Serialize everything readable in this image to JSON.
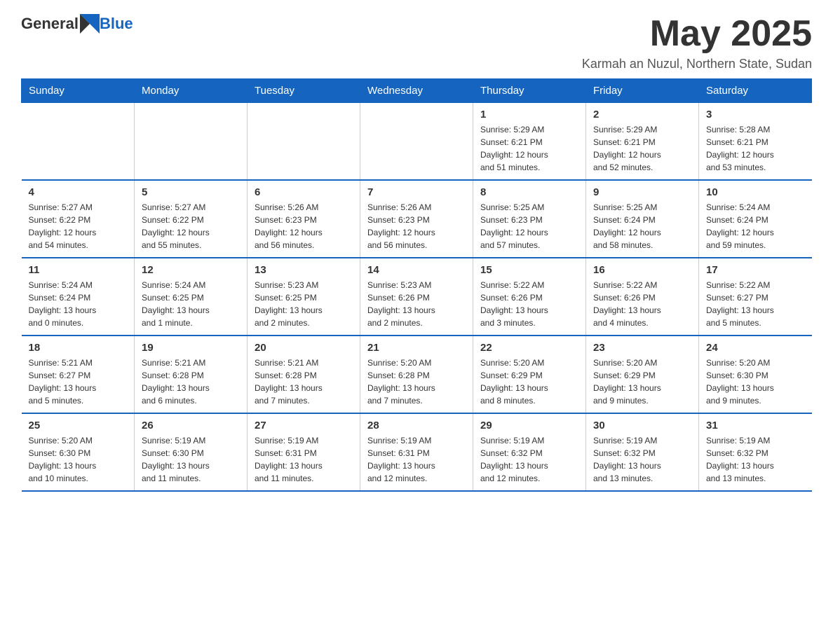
{
  "logo": {
    "general": "General",
    "blue": "Blue"
  },
  "title": {
    "month_year": "May 2025",
    "location": "Karmah an Nuzul, Northern State, Sudan"
  },
  "days_of_week": [
    "Sunday",
    "Monday",
    "Tuesday",
    "Wednesday",
    "Thursday",
    "Friday",
    "Saturday"
  ],
  "weeks": [
    [
      {
        "day": "",
        "info": ""
      },
      {
        "day": "",
        "info": ""
      },
      {
        "day": "",
        "info": ""
      },
      {
        "day": "",
        "info": ""
      },
      {
        "day": "1",
        "info": "Sunrise: 5:29 AM\nSunset: 6:21 PM\nDaylight: 12 hours\nand 51 minutes."
      },
      {
        "day": "2",
        "info": "Sunrise: 5:29 AM\nSunset: 6:21 PM\nDaylight: 12 hours\nand 52 minutes."
      },
      {
        "day": "3",
        "info": "Sunrise: 5:28 AM\nSunset: 6:21 PM\nDaylight: 12 hours\nand 53 minutes."
      }
    ],
    [
      {
        "day": "4",
        "info": "Sunrise: 5:27 AM\nSunset: 6:22 PM\nDaylight: 12 hours\nand 54 minutes."
      },
      {
        "day": "5",
        "info": "Sunrise: 5:27 AM\nSunset: 6:22 PM\nDaylight: 12 hours\nand 55 minutes."
      },
      {
        "day": "6",
        "info": "Sunrise: 5:26 AM\nSunset: 6:23 PM\nDaylight: 12 hours\nand 56 minutes."
      },
      {
        "day": "7",
        "info": "Sunrise: 5:26 AM\nSunset: 6:23 PM\nDaylight: 12 hours\nand 56 minutes."
      },
      {
        "day": "8",
        "info": "Sunrise: 5:25 AM\nSunset: 6:23 PM\nDaylight: 12 hours\nand 57 minutes."
      },
      {
        "day": "9",
        "info": "Sunrise: 5:25 AM\nSunset: 6:24 PM\nDaylight: 12 hours\nand 58 minutes."
      },
      {
        "day": "10",
        "info": "Sunrise: 5:24 AM\nSunset: 6:24 PM\nDaylight: 12 hours\nand 59 minutes."
      }
    ],
    [
      {
        "day": "11",
        "info": "Sunrise: 5:24 AM\nSunset: 6:24 PM\nDaylight: 13 hours\nand 0 minutes."
      },
      {
        "day": "12",
        "info": "Sunrise: 5:24 AM\nSunset: 6:25 PM\nDaylight: 13 hours\nand 1 minute."
      },
      {
        "day": "13",
        "info": "Sunrise: 5:23 AM\nSunset: 6:25 PM\nDaylight: 13 hours\nand 2 minutes."
      },
      {
        "day": "14",
        "info": "Sunrise: 5:23 AM\nSunset: 6:26 PM\nDaylight: 13 hours\nand 2 minutes."
      },
      {
        "day": "15",
        "info": "Sunrise: 5:22 AM\nSunset: 6:26 PM\nDaylight: 13 hours\nand 3 minutes."
      },
      {
        "day": "16",
        "info": "Sunrise: 5:22 AM\nSunset: 6:26 PM\nDaylight: 13 hours\nand 4 minutes."
      },
      {
        "day": "17",
        "info": "Sunrise: 5:22 AM\nSunset: 6:27 PM\nDaylight: 13 hours\nand 5 minutes."
      }
    ],
    [
      {
        "day": "18",
        "info": "Sunrise: 5:21 AM\nSunset: 6:27 PM\nDaylight: 13 hours\nand 5 minutes."
      },
      {
        "day": "19",
        "info": "Sunrise: 5:21 AM\nSunset: 6:28 PM\nDaylight: 13 hours\nand 6 minutes."
      },
      {
        "day": "20",
        "info": "Sunrise: 5:21 AM\nSunset: 6:28 PM\nDaylight: 13 hours\nand 7 minutes."
      },
      {
        "day": "21",
        "info": "Sunrise: 5:20 AM\nSunset: 6:28 PM\nDaylight: 13 hours\nand 7 minutes."
      },
      {
        "day": "22",
        "info": "Sunrise: 5:20 AM\nSunset: 6:29 PM\nDaylight: 13 hours\nand 8 minutes."
      },
      {
        "day": "23",
        "info": "Sunrise: 5:20 AM\nSunset: 6:29 PM\nDaylight: 13 hours\nand 9 minutes."
      },
      {
        "day": "24",
        "info": "Sunrise: 5:20 AM\nSunset: 6:30 PM\nDaylight: 13 hours\nand 9 minutes."
      }
    ],
    [
      {
        "day": "25",
        "info": "Sunrise: 5:20 AM\nSunset: 6:30 PM\nDaylight: 13 hours\nand 10 minutes."
      },
      {
        "day": "26",
        "info": "Sunrise: 5:19 AM\nSunset: 6:30 PM\nDaylight: 13 hours\nand 11 minutes."
      },
      {
        "day": "27",
        "info": "Sunrise: 5:19 AM\nSunset: 6:31 PM\nDaylight: 13 hours\nand 11 minutes."
      },
      {
        "day": "28",
        "info": "Sunrise: 5:19 AM\nSunset: 6:31 PM\nDaylight: 13 hours\nand 12 minutes."
      },
      {
        "day": "29",
        "info": "Sunrise: 5:19 AM\nSunset: 6:32 PM\nDaylight: 13 hours\nand 12 minutes."
      },
      {
        "day": "30",
        "info": "Sunrise: 5:19 AM\nSunset: 6:32 PM\nDaylight: 13 hours\nand 13 minutes."
      },
      {
        "day": "31",
        "info": "Sunrise: 5:19 AM\nSunset: 6:32 PM\nDaylight: 13 hours\nand 13 minutes."
      }
    ]
  ]
}
